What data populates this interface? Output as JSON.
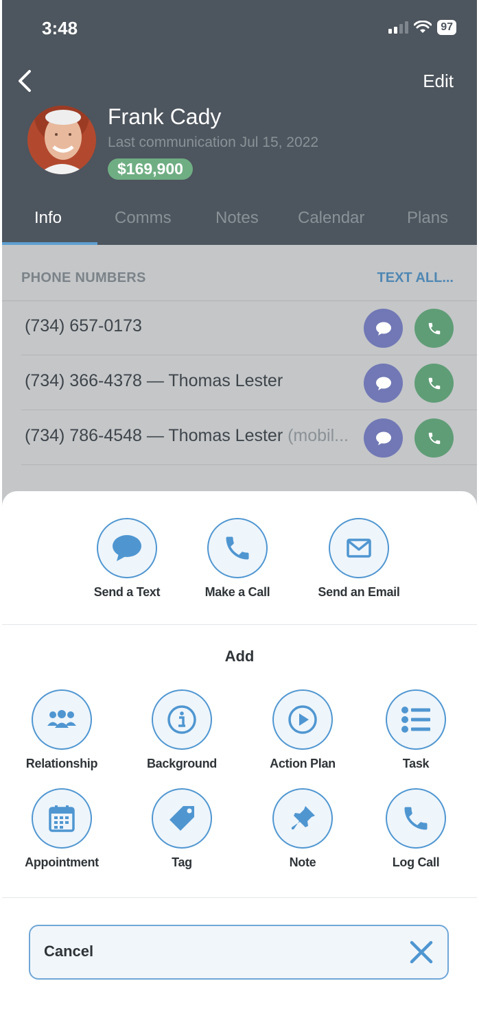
{
  "status_bar": {
    "time": "3:48",
    "battery": "97"
  },
  "header": {
    "edit_label": "Edit",
    "contact_name": "Frank Cady",
    "last_communication": "Last communication Jul 15, 2022",
    "price": "$169,900"
  },
  "tabs": [
    {
      "label": "Info",
      "active": true
    },
    {
      "label": "Comms"
    },
    {
      "label": "Notes"
    },
    {
      "label": "Calendar"
    },
    {
      "label": "Plans"
    }
  ],
  "phone_section": {
    "title": "PHONE NUMBERS",
    "text_all": "TEXT ALL...",
    "numbers": [
      {
        "number": "(734) 657-0173",
        "label": "",
        "type": ""
      },
      {
        "number": "(734) 366-4378",
        "label": " — Thomas Lester",
        "type": ""
      },
      {
        "number": "(734) 786-4548",
        "label": " — Thomas Lester",
        "type": " (mobil..."
      }
    ]
  },
  "sheet": {
    "quick_actions": [
      {
        "label": "Send a Text",
        "icon": "speech-bubble-icon"
      },
      {
        "label": "Make a Call",
        "icon": "phone-icon"
      },
      {
        "label": "Send an Email",
        "icon": "envelope-icon"
      }
    ],
    "add_title": "Add",
    "add_items": [
      {
        "label": "Relationship",
        "icon": "people-icon"
      },
      {
        "label": "Background",
        "icon": "info-icon"
      },
      {
        "label": "Action Plan",
        "icon": "play-icon"
      },
      {
        "label": "Task",
        "icon": "list-icon"
      },
      {
        "label": "Appointment",
        "icon": "calendar-icon"
      },
      {
        "label": "Tag",
        "icon": "tag-icon"
      },
      {
        "label": "Note",
        "icon": "pushpin-icon"
      },
      {
        "label": "Log Call",
        "icon": "phone-icon"
      }
    ],
    "cancel_label": "Cancel"
  },
  "colors": {
    "accent": "#4f96d1",
    "header_bg": "#4d555e",
    "price_badge": "#6fae83",
    "text_button": "#7178b5",
    "call_button": "#5f9d76"
  }
}
